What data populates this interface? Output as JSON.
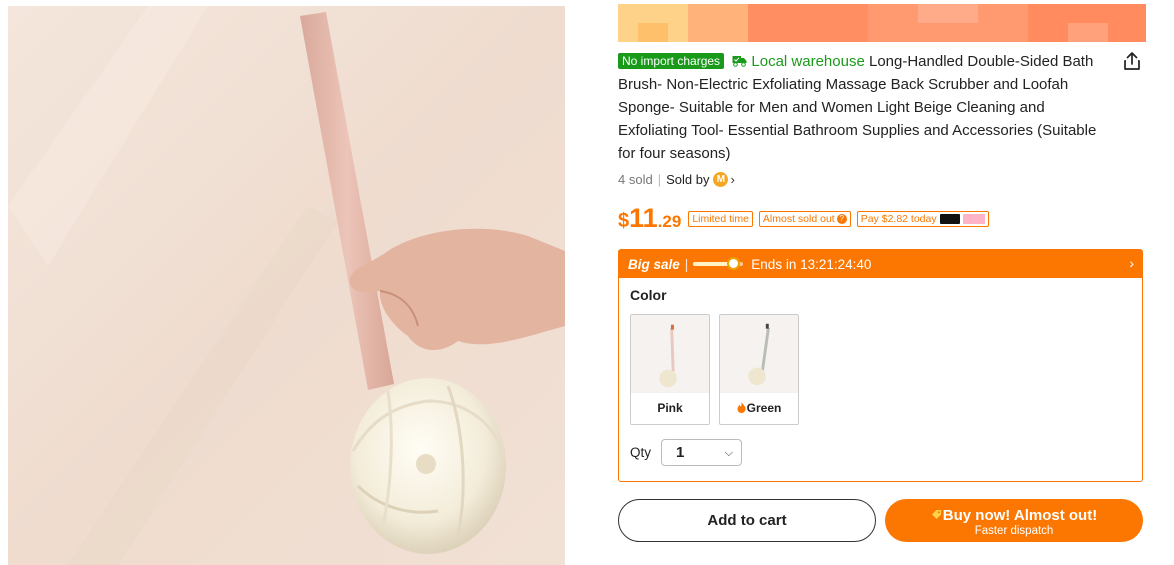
{
  "header": {
    "pixelated": true
  },
  "product": {
    "badge_import": "No import charges",
    "local_warehouse": "Local warehouse",
    "title": "Long-Handled Double-Sided Bath Brush- Non-Electric Exfoliating Massage Back Scrubber and Loofah Sponge- Suitable for Men and Women Light Beige Cleaning and Exfoliating Tool- Essential Bathroom Supplies and Accessories (Suitable for four seasons)",
    "sold_count": "4 sold",
    "sold_by": "Sold by",
    "seller_logo_letter": "M"
  },
  "price": {
    "currency": "$",
    "integer": "11",
    "decimal": ".29",
    "tags": {
      "limited_time": "Limited time",
      "almost_sold_out": "Almost sold out",
      "pay_today": "Pay $2.82 today"
    },
    "help_icon": "?"
  },
  "sale": {
    "label": "Big sale",
    "separator": "|",
    "countdown": "Ends in 13:21:24:40",
    "progress": 0.8
  },
  "options": {
    "color_label": "Color",
    "swatches": [
      {
        "name": "Pink",
        "handle_color": "#e8c9bf"
      },
      {
        "name": "Green",
        "handle_color": "#b9bdb4"
      }
    ],
    "qty_label": "Qty",
    "qty_value": "1"
  },
  "actions": {
    "add_to_cart": "Add to cart",
    "buy_now": "Buy now! Almost out!",
    "buy_now_sub": "Faster dispatch"
  },
  "colors": {
    "accent": "#fb7701",
    "green_badge": "#1a9a1a"
  },
  "icons": [
    "share-icon",
    "truck-icon",
    "chevron-right-icon",
    "question-icon",
    "chevron-down-icon",
    "fire-icon",
    "tag-icon"
  ]
}
